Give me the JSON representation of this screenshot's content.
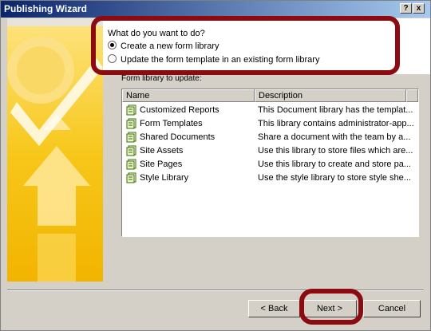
{
  "window": {
    "title": "Publishing Wizard",
    "help_label": "?",
    "close_label": "x"
  },
  "options": {
    "question": "What do you want to do?",
    "choices": [
      {
        "label": "Create a new form library",
        "selected": true
      },
      {
        "label": "Update the form template in an existing form library",
        "selected": false
      }
    ]
  },
  "list": {
    "label": "Form library to update:",
    "columns": [
      "Name",
      "Description"
    ],
    "rows": [
      {
        "name": "Customized Reports",
        "description": "This Document library has the templat..."
      },
      {
        "name": "Form Templates",
        "description": "This library contains administrator-app..."
      },
      {
        "name": "Shared Documents",
        "description": "Share a document with the team by a..."
      },
      {
        "name": "Site Assets",
        "description": "Use this library to store files which are..."
      },
      {
        "name": "Site Pages",
        "description": "Use this library to create and store pa..."
      },
      {
        "name": "Style Library",
        "description": "Use the style library to store style she..."
      }
    ]
  },
  "buttons": {
    "back": "< Back",
    "next": "Next >",
    "cancel": "Cancel"
  },
  "colors": {
    "highlight": "#8c0b10",
    "titlebar": "#0a246a",
    "dialog": "#d4d0c8",
    "banner_yellow": "#f5c400"
  }
}
